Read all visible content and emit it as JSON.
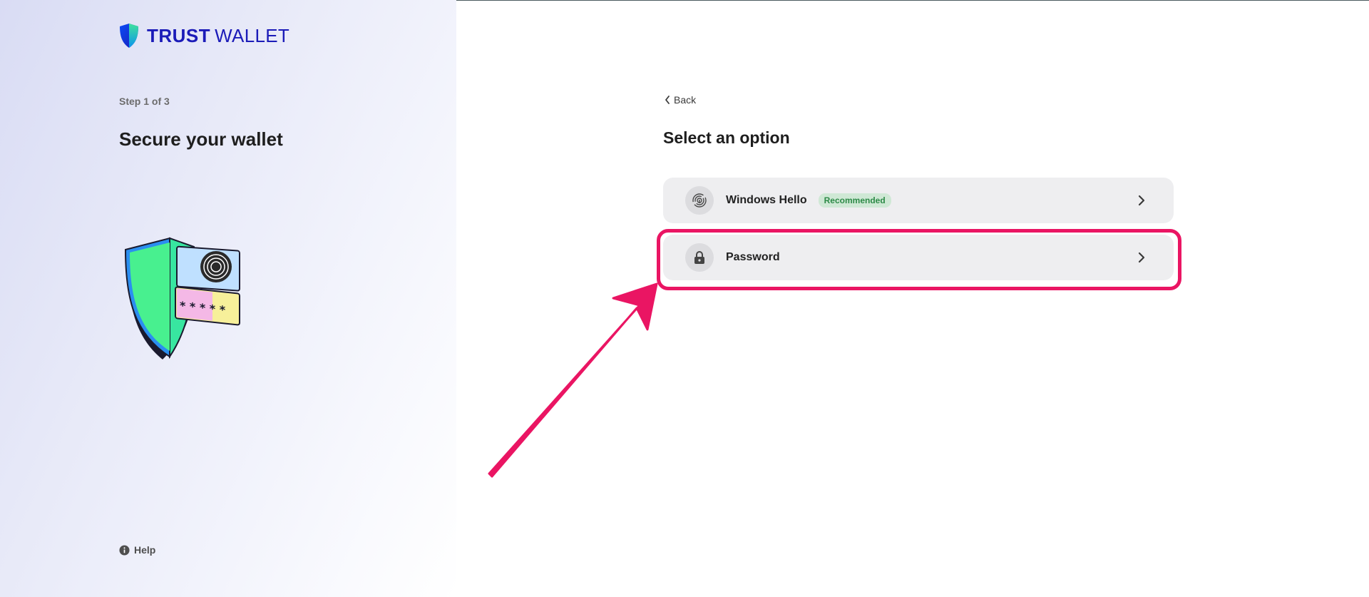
{
  "brand": {
    "name_bold": "TRUST",
    "name_light": "WALLET",
    "color": "#1b1bb8"
  },
  "left": {
    "step": "Step 1 of 3",
    "title": "Secure your wallet",
    "help_label": "Help"
  },
  "right": {
    "back_label": "Back",
    "title": "Select an option",
    "options": [
      {
        "label": "Windows Hello",
        "badge": "Recommended",
        "icon": "fingerprint-icon"
      },
      {
        "label": "Password",
        "badge": "",
        "icon": "lock-icon"
      }
    ]
  },
  "colors": {
    "highlight": "#ea1563",
    "badge_bg": "#cfe8d5",
    "badge_text": "#2d8a47",
    "option_bg": "#eeeef0"
  }
}
